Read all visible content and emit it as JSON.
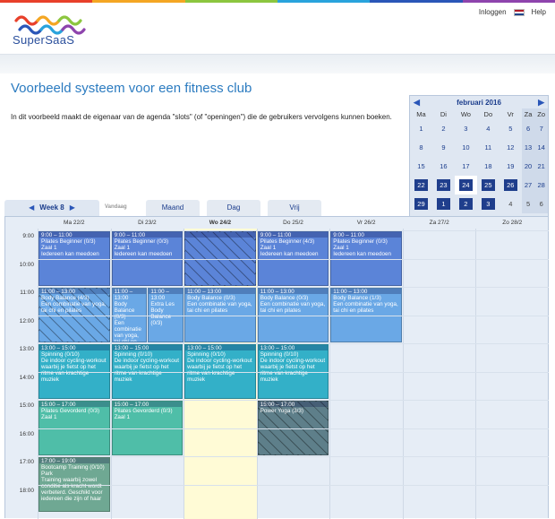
{
  "brand": {
    "name": "SuperSaaS",
    "stripe_colors": [
      "#e8402a",
      "#f4a623",
      "#8cc63f",
      "#29a3dc",
      "#2a56b8",
      "#8e44ad"
    ]
  },
  "topnav": {
    "login": "Inloggen",
    "help": "Help",
    "language_flag": "flag-nl-icon"
  },
  "page": {
    "title": "Voorbeeld systeem voor een fitness club",
    "intro": "In dit voorbeeld maakt de eigenaar van de agenda \"slots\" (of \"openingen\") die de gebruikers vervolgens kunnen boeken."
  },
  "minical": {
    "month": "februari 2016",
    "weekdays": [
      "Ma",
      "Di",
      "Wo",
      "Do",
      "Vr",
      "Za",
      "Zo"
    ],
    "rows": [
      [
        "1",
        "2",
        "3",
        "4",
        "5",
        "6",
        "7"
      ],
      [
        "8",
        "9",
        "10",
        "11",
        "12",
        "13",
        "14"
      ],
      [
        "15",
        "16",
        "17",
        "18",
        "19",
        "20",
        "21"
      ],
      [
        "22",
        "23",
        "24",
        "25",
        "26",
        "27",
        "28"
      ],
      [
        "29",
        "1",
        "2",
        "3",
        "4",
        "5",
        "6"
      ]
    ]
  },
  "weekbar": {
    "week_label": "Week 8",
    "today": "Vandaag",
    "tabs": [
      "Maand",
      "Dag",
      "Vrij"
    ]
  },
  "days": [
    "Ma 22/2",
    "Di 23/2",
    "Wo 24/2",
    "Do 25/2",
    "Vr 26/2",
    "Za 27/2",
    "Zo 28/2"
  ],
  "hours": [
    "9:00",
    "10:00",
    "11:00",
    "12:00",
    "13:00",
    "14:00",
    "15:00",
    "16:00",
    "17:00",
    "18:00"
  ],
  "events": [
    {
      "day": 0,
      "start": 9,
      "end": 11,
      "color": "c-blue",
      "time": "9:00 – 11:00",
      "title": "Pilates Beginner (0/3)",
      "sub": "Zaal 1",
      "desc": "Iedereen kan meedoen"
    },
    {
      "day": 1,
      "start": 9,
      "end": 11,
      "color": "c-blue",
      "time": "9:00 – 11:00",
      "title": "Pilates Beginner (0/3)",
      "sub": "Zaal 1",
      "desc": "Iedereen kan meedoen"
    },
    {
      "day": 2,
      "start": 9,
      "end": 11,
      "color": "c-blue",
      "hatch": true,
      "time": "",
      "title": "",
      "sub": "",
      "desc": ""
    },
    {
      "day": 3,
      "start": 9,
      "end": 11,
      "color": "c-blue",
      "time": "9:00 – 11:00",
      "title": "Pilates Beginner (4/3)",
      "sub": "Zaal 1",
      "desc": "Iedereen kan meedoen"
    },
    {
      "day": 4,
      "start": 9,
      "end": 11,
      "color": "c-blue",
      "time": "9:00 – 11:00",
      "title": "Pilates Beginner (0/3)",
      "sub": "Zaal 1",
      "desc": "Iedereen kan meedoen"
    },
    {
      "day": 0,
      "start": 11,
      "end": 13,
      "color": "c-lblue",
      "hatch": true,
      "time": "11:00 – 13:00",
      "title": "Body Balance (4/3)",
      "sub": "",
      "desc": "Een combinatie van yoga, tai chi en pilates"
    },
    {
      "day": 1,
      "start": 11,
      "end": 13,
      "color": "c-lblue",
      "half": 0,
      "time": "11:00 – 13:00",
      "title": "Body Balance (0/3)",
      "sub": "",
      "desc": "Een combinatie van yoga, tai chi en pilates"
    },
    {
      "day": 1,
      "start": 11,
      "end": 13,
      "color": "c-lblue",
      "half": 1,
      "time": "11:00 – 13:00",
      "title": "Extra Les Body Balance (0/3)",
      "sub": "",
      "desc": ""
    },
    {
      "day": 2,
      "start": 11,
      "end": 13,
      "color": "c-lblue",
      "time": "11:00 – 13:00",
      "title": "Body Balance (0/3)",
      "sub": "",
      "desc": "Een combinatie van yoga, tai chi en pilates"
    },
    {
      "day": 3,
      "start": 11,
      "end": 13,
      "color": "c-lblue",
      "time": "11:00 – 13:00",
      "title": "Body Balance (0/3)",
      "sub": "",
      "desc": "Een combinatie van yoga, tai chi en pilates"
    },
    {
      "day": 4,
      "start": 11,
      "end": 13,
      "color": "c-lblue",
      "time": "11:00 – 13:00",
      "title": "Body Balance (1/3)",
      "sub": "",
      "desc": "Een combinatie van yoga, tai chi en pilates"
    },
    {
      "day": 0,
      "start": 13,
      "end": 15,
      "color": "c-teal",
      "time": "13:00 – 15:00",
      "title": "Spinning (0/10)",
      "sub": "",
      "desc": "De indoor cycling-workout waarbij je fietst op het ritme van krachtige muziek"
    },
    {
      "day": 1,
      "start": 13,
      "end": 15,
      "color": "c-teal",
      "time": "13:00 – 15:00",
      "title": "Spinning (0/10)",
      "sub": "",
      "desc": "De indoor cycling-workout waarbij je fietst op het ritme van krachtige muziek"
    },
    {
      "day": 2,
      "start": 13,
      "end": 15,
      "color": "c-teal",
      "time": "13:00 – 15:00",
      "title": "Spinning (0/10)",
      "sub": "",
      "desc": "De indoor cycling-workout waarbij je fietst op het ritme van krachtige muziek"
    },
    {
      "day": 3,
      "start": 13,
      "end": 15,
      "color": "c-teal",
      "time": "13:00 – 15:00",
      "title": "Spinning (0/10)",
      "sub": "",
      "desc": "De indoor cycling-workout waarbij je fietst op het ritme van krachtige muziek"
    },
    {
      "day": 0,
      "start": 15,
      "end": 17,
      "color": "c-green",
      "time": "15:00 – 17:00",
      "title": "Pilates Gevorderd (0/3)",
      "sub": "Zaal 1",
      "desc": ""
    },
    {
      "day": 1,
      "start": 15,
      "end": 17,
      "color": "c-green",
      "time": "15:00 – 17:00",
      "title": "Pilates Gevorderd (0/3)",
      "sub": "Zaal 1",
      "desc": ""
    },
    {
      "day": 3,
      "start": 15,
      "end": 17,
      "color": "c-grey",
      "hatch": true,
      "time": "15:00 – 17:00",
      "title": "Power Yoga (3/3)",
      "sub": "",
      "desc": ""
    },
    {
      "day": 0,
      "start": 17,
      "end": 19,
      "color": "c-dgreen",
      "time": "17:00 – 19:00",
      "title": "Bootcamp Training (0/10)",
      "sub": "Park",
      "desc": "Training waarbij zowel conditie als kracht wordt verbeterd. Geschikt voor iedereen die zijn of haar"
    }
  ]
}
